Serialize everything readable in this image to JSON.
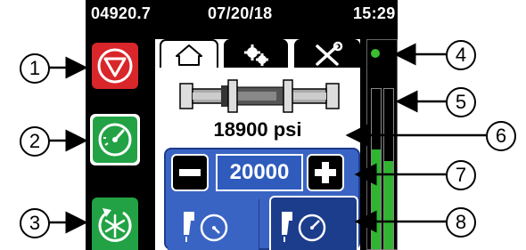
{
  "status_bar": {
    "counter": "04920.7",
    "date": "07/20/18",
    "time": "15:29"
  },
  "tabs": [
    {
      "icon": "home-icon",
      "active": true
    },
    {
      "icon": "gears-icon",
      "active": false
    },
    {
      "icon": "tools-icon",
      "active": false
    }
  ],
  "pressure": {
    "value": "18900 psi"
  },
  "setpoint": {
    "value": "20000",
    "minus_label": "−",
    "plus_label": "+"
  },
  "callouts": [
    "1",
    "2",
    "3",
    "4",
    "5",
    "6",
    "7",
    "8"
  ],
  "colors": {
    "stop_red": "#d8262a",
    "mode_green": "#22a244",
    "accent_blue": "#3a64c4",
    "indicator_green": "#3bbf2f",
    "bar_green": "#2fb52f"
  }
}
